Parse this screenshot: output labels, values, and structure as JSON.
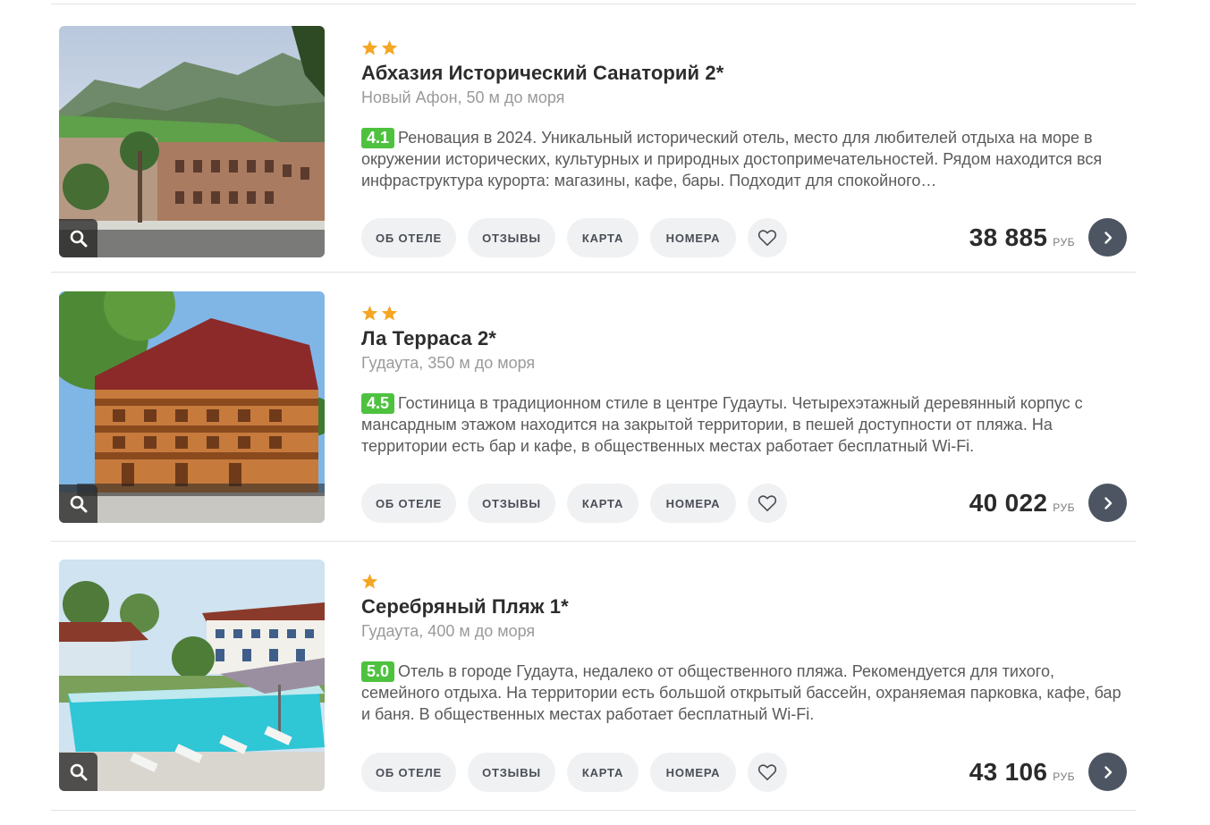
{
  "hotels": [
    {
      "stars": 2,
      "name": "Абхазия Исторический Санаторий 2*",
      "location": "Новый Афон, 50 м до моря",
      "rating": "4.1",
      "description": "Реновация в 2024. Уникальный исторический отель, место для любителей отдыха на море в окружении исторических, культурных и природных достопримечательностей. Рядом находится вся инфраструктура курорта: магазины, кафе, бары. Подходит для спокойного…",
      "price": "38 885",
      "currency": "РУБ"
    },
    {
      "stars": 2,
      "name": "Ла Терраса 2*",
      "location": "Гудаута, 350 м до моря",
      "rating": "4.5",
      "description": "Гостиница в традиционном стиле в центре Гудауты. Четырехэтажный деревянный корпус с мансардным этажом находится на закрытой территории, в пешей доступности от пляжа. На территории есть бар и кафе, в общественных местах работает бесплатный Wi-Fi.",
      "price": "40 022",
      "currency": "РУБ"
    },
    {
      "stars": 1,
      "name": "Серебряный Пляж 1*",
      "location": "Гудаута, 400 м до моря",
      "rating": "5.0",
      "description": "Отель в городе Гудаута, недалеко от общественного пляжа. Рекомендуется для тихого, семейного отдыха. На территории есть большой открытый бассейн, охраняемая парковка, кафе, бар и баня. В общественных местах работает бесплатный Wi-Fi.",
      "price": "43 106",
      "currency": "РУБ"
    }
  ],
  "buttons": {
    "about": "ОБ ОТЕЛЕ",
    "reviews": "ОТЗЫВЫ",
    "map": "КАРТА",
    "rooms": "НОМЕРА"
  },
  "icons": {
    "star": "star-icon",
    "zoom": "search-icon",
    "favorite": "heart-icon",
    "go": "chevron-right-icon"
  },
  "colors": {
    "star": "#f5a623",
    "rating_badge": "#4ec23f",
    "go_button": "#4d5562",
    "pill": "#f0f1f3"
  }
}
